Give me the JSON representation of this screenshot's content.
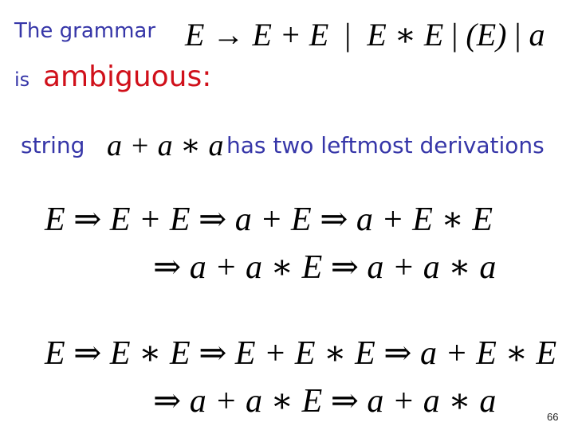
{
  "slide": {
    "intro_line1": "The grammar",
    "grammar": {
      "lhs": "E",
      "arrow": "→",
      "alternatives": [
        "E + E",
        "E ∗ E",
        "(E)",
        "a"
      ],
      "separator": "|"
    },
    "intro_line2_prefix": "is",
    "intro_line2_emphasis": "ambiguous:",
    "string_prefix": "string",
    "string_value": "a + a ∗ a",
    "string_suffix": "has two leftmost derivations",
    "derivation1": {
      "line1": "E ⇒ E + E ⇒ a + E ⇒ a + E ∗ E",
      "line2": "⇒ a + a ∗ E ⇒ a + a ∗ a"
    },
    "derivation2": {
      "line1": "E ⇒ E ∗ E ⇒ E + E ∗ E ⇒ a + E ∗ E",
      "line2": "⇒ a + a ∗ E ⇒ a + a ∗ a"
    },
    "page_number": "66",
    "colors": {
      "text_blue": "#3636a8",
      "emphasis_red": "#d0101a",
      "math_black": "#000000"
    }
  }
}
